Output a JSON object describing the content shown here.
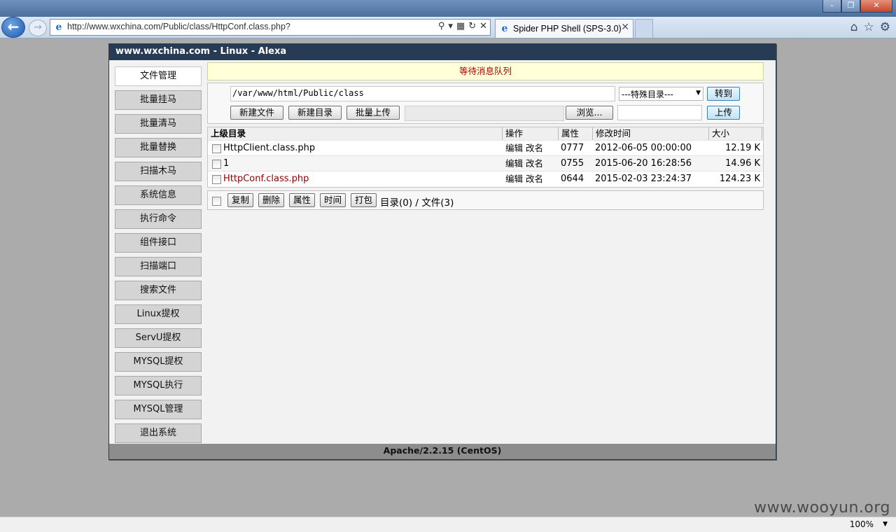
{
  "browser": {
    "url": "http://www.wxchina.com/Public/class/HttpConf.class.php?",
    "tab_title": "Spider PHP Shell (SPS-3.0)",
    "zoom": "100%"
  },
  "panel": {
    "header": "www.wxchina.com - Linux - Alexa",
    "footer": "Apache/2.2.15 (CentOS)"
  },
  "sidebar": {
    "items": [
      {
        "label": "文件管理"
      },
      {
        "label": "批量挂马"
      },
      {
        "label": "批量清马"
      },
      {
        "label": "批量替换"
      },
      {
        "label": "扫描木马"
      },
      {
        "label": "系统信息"
      },
      {
        "label": "执行命令"
      },
      {
        "label": "组件接口"
      },
      {
        "label": "扫描端口"
      },
      {
        "label": "搜索文件"
      },
      {
        "label": "Linux提权"
      },
      {
        "label": "ServU提权"
      },
      {
        "label": "MYSQL提权"
      },
      {
        "label": "MYSQL执行"
      },
      {
        "label": "MYSQL管理"
      },
      {
        "label": "退出系统"
      }
    ]
  },
  "notice": "等待消息队列",
  "toolbox": {
    "path": "/var/www/html/Public/class",
    "special_dir": "---特殊目录---",
    "goto_label": "转到",
    "new_file_label": "新建文件",
    "new_dir_label": "新建目录",
    "batch_upload_label": "批量上传",
    "browse_label": "浏览...",
    "upload_label": "上传"
  },
  "table": {
    "headers": {
      "name": "上级目录",
      "ops": "操作",
      "perm": "属性",
      "time": "修改时间",
      "size": "大小"
    },
    "rows": [
      {
        "name": "HttpClient.class.php",
        "edit": "编辑",
        "rename": "改名",
        "perm": "0777",
        "time": "2012-06-05 00:00:00",
        "size": "12.19 K"
      },
      {
        "name": "1",
        "edit": "编辑",
        "rename": "改名",
        "perm": "0755",
        "time": "2015-06-20 16:28:56",
        "size": "14.96 K"
      },
      {
        "name": "HttpConf.class.php",
        "edit": "编辑",
        "rename": "改名",
        "perm": "0644",
        "time": "2015-02-03 23:24:37",
        "size": "124.23 K"
      }
    ]
  },
  "actions": {
    "copy": "复制",
    "delete": "删除",
    "attributes": "属性",
    "time": "时间",
    "pack": "打包",
    "summary": "目录(0) / 文件(3)"
  },
  "watermark": "www.wooyun.org",
  "colors": {
    "header_bg": "#283b54",
    "notice_text": "#b00000",
    "highlight_file": "#8b0000"
  }
}
